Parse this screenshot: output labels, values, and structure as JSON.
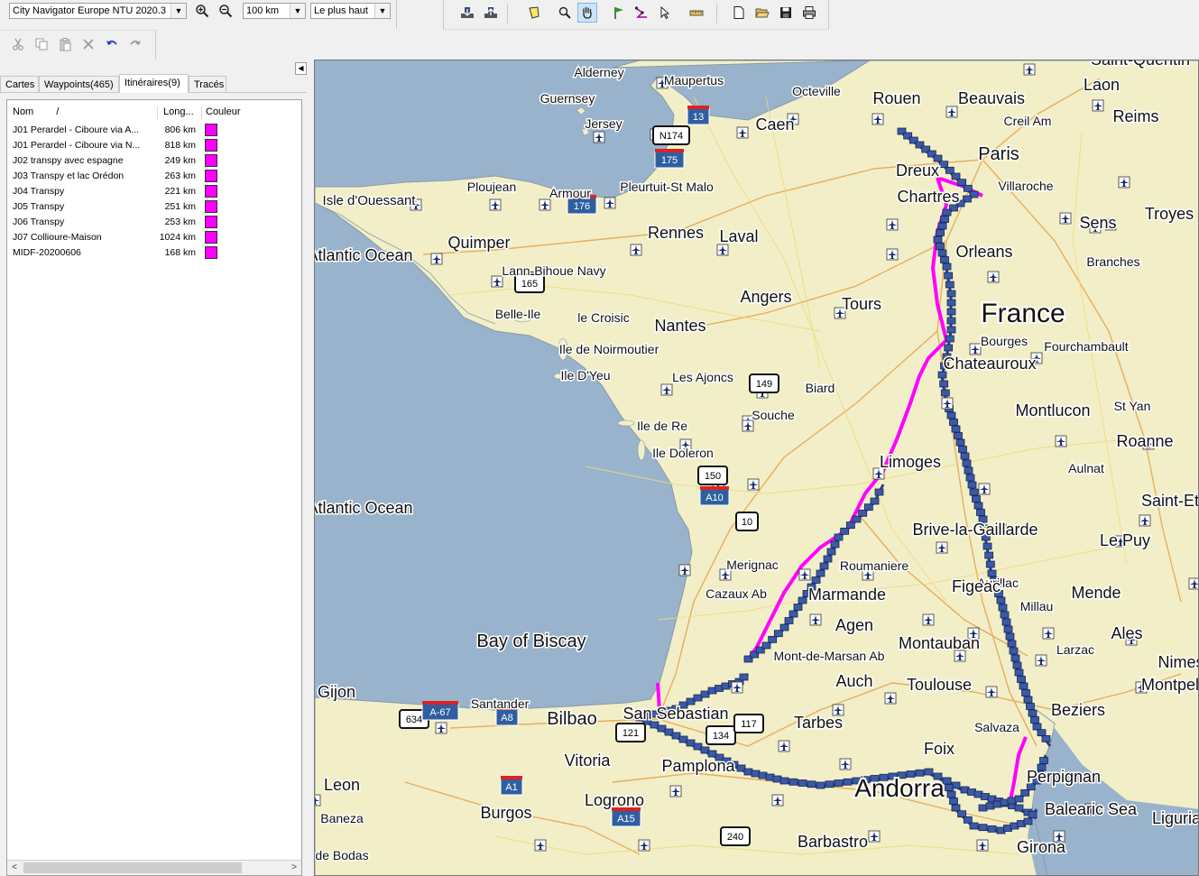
{
  "toolbar": {
    "map_product": "City Navigator Europe NTU 2020.3",
    "zoom_scale": "100 km",
    "detail_level": "Le plus haut"
  },
  "tabs": [
    {
      "label": "Cartes"
    },
    {
      "label": "Waypoints(465)"
    },
    {
      "label": "Itinéraires(9)",
      "active": true
    },
    {
      "label": "Tracés"
    }
  ],
  "list": {
    "headers": {
      "name": "Nom",
      "sort": "/",
      "length": "Long...",
      "color": "Couleur"
    },
    "routes": [
      {
        "name": "J01 Perardel - Ciboure via A...",
        "length": "806 km",
        "color": "#ff00ff"
      },
      {
        "name": "J01 Perardel - Ciboure via N...",
        "length": "818 km",
        "color": "#ff00ff"
      },
      {
        "name": "J02 transpy avec espagne",
        "length": "249 km",
        "color": "#ff00ff"
      },
      {
        "name": "J03 Transpy et lac Orédon",
        "length": "263 km",
        "color": "#ff00ff"
      },
      {
        "name": "J04 Transpy",
        "length": "221 km",
        "color": "#ff00ff"
      },
      {
        "name": "J05 Transpy",
        "length": "251 km",
        "color": "#ff00ff"
      },
      {
        "name": "J06 Transpy",
        "length": "253 km",
        "color": "#ff00ff"
      },
      {
        "name": "J07 Collioure-Maison",
        "length": "1024 km",
        "color": "#ff00ff"
      },
      {
        "name": "MIDF-20200606",
        "length": "168 km",
        "color": "#ff00ff"
      }
    ]
  },
  "map": {
    "colors": {
      "sea": "#99b3cc",
      "land": "#f2efc8",
      "route": "#ff00ff",
      "track": "#3a5aa8"
    },
    "labels": {
      "alderney": "Alderney",
      "maupertus": "Maupertus",
      "guernsey": "Guernsey",
      "jersey": "Jersey",
      "octeville": "Octeville",
      "caen": "Caen",
      "rouen": "Rouen",
      "beauvais": "Beauvais",
      "laon": "Laon",
      "saint_quentin": "Saint-Quentin",
      "reims": "Reims",
      "creil": "Creil Am",
      "paris": "Paris",
      "dreux": "Dreux",
      "villaroche": "Villaroche",
      "chartres": "Chartres",
      "ouessant": "Isle d'Ouessant",
      "ploujean": "Ploujean",
      "armour": "Armour",
      "pleurtuit": "Pleurtuit-St Malo",
      "sens": "Sens",
      "troyes": "Troyes",
      "quimper": "Quimper",
      "rennes": "Rennes",
      "laval": "Laval",
      "orleans": "Orleans",
      "ocean1": "Atlantic Ocean",
      "lann_bihoue": "Lann-Bihoue Navy",
      "branches": "Branches",
      "france": "France",
      "belle_ile": "Belle-Ile",
      "le_croisic": "le Croisic",
      "nantes": "Nantes",
      "angers": "Angers",
      "tours": "Tours",
      "noirmoutier": "Ile de Noirmoutier",
      "bourges": "Bourges",
      "fourchambault": "Fourchambault",
      "chateauroux": "Chateauroux",
      "yeu": "Ile D'Yeu",
      "ajoncs": "Les Ajoncs",
      "biard": "Biard",
      "montlucon": "Montlucon",
      "st_yan": "St Yan",
      "souche": "Souche",
      "ile_de_re": "Ile de Re",
      "roanne": "Roanne",
      "oleron": "Ile Doleron",
      "limoges": "Limoges",
      "aulnat": "Aulnat",
      "ocean2": "Atlantic Ocean",
      "brive": "Brive-la-Gaillarde",
      "le_puy": "Le Puy",
      "saint_etienne": "Saint-Etienne",
      "merignac": "Merignac",
      "roumaniere": "Roumaniere",
      "aurillac": "Aurillac",
      "cazaux": "Cazaux Ab",
      "bergerac": "Marmande",
      "figeac": "Figeac",
      "mende": "Mende",
      "agen": "Agen",
      "millau": "Millau",
      "bay": "Bay of Biscay",
      "mont_marsan": "Mont-de-Marsan Ab",
      "montauban": "Montauban",
      "ales": "Ales",
      "larzac": "Larzac",
      "nimes": "Nimes",
      "gijon": "Gijon",
      "auch": "Auch",
      "toulouse": "Toulouse",
      "montpellier": "Montpellier",
      "santander": "Santander",
      "bilbao": "Bilbao",
      "san_sebastian": "San Sebastian",
      "tarbes": "Tarbes",
      "salvaza": "Salvaza",
      "beziers": "Beziers",
      "foix": "Foix",
      "vitoria": "Vitoria",
      "pamplona": "Pamplona",
      "perpignan": "Perpignan",
      "leon": "Leon",
      "andorra": "Andorra",
      "balearic": "Balearic Sea",
      "logrono": "Logrono",
      "burgos": "Burgos",
      "baneza": "Baneza",
      "barbastro": "Barbastro",
      "girona": "Girona",
      "bodas": "de Bodas",
      "ligurian": "Ligurian"
    },
    "shields": {
      "s13": "13",
      "n174": "N174",
      "s175": "175",
      "s176": "176",
      "s165": "165",
      "s149": "149",
      "s150": "150",
      "a10": "A10",
      "s10": "10",
      "s634": "634",
      "a67": "A-67",
      "a8": "A8",
      "s121": "121",
      "s134": "134",
      "s117": "117",
      "a1": "A1",
      "a15": "A15",
      "s240": "240"
    }
  }
}
